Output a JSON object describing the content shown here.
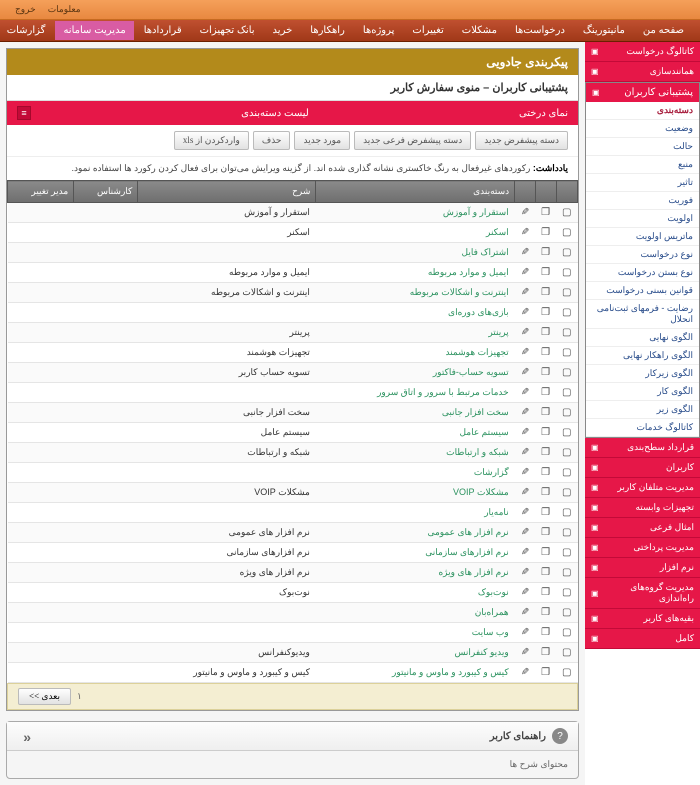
{
  "topbar": {
    "items": [
      "معلومات",
      "خروج"
    ]
  },
  "mainnav": {
    "items": [
      "صفحه من",
      "مانیتورینگ",
      "درخواست‌ها",
      "مشکلات",
      "تغییرات",
      "پروژه‌ها",
      "راهکارها",
      "خرید",
      "بانک تجهیزات",
      "قراردادها",
      "مدیریت سامانه",
      "گزارشات"
    ],
    "activeIndex": 10
  },
  "headerbar": {
    "right": "کاتالوگ درخواست",
    "left": "همانندسازی"
  },
  "sidebar": {
    "section1": {
      "title": "پشتیبانی کاربران",
      "links": [
        "دسته‌بندی",
        "وضعیت",
        "حالت",
        "منبع",
        "تاثیر",
        "فوریت",
        "اولویت",
        "ماتریس اولویت",
        "نوع درخواست",
        "نوع بستن درخواست",
        "قوانین بسنی درخواست",
        "رضایت - فرمهای ثبت‌نامی انحلال",
        "الگوی نهایی",
        "الگوی راهکار نهایی",
        "الگوی زیرکار",
        "الگوی کار",
        "الگوی زیر",
        "کاتالوگ خدمات"
      ],
      "activeIndex": 0
    },
    "redlinks": [
      "قرارداد سطح‌بندی",
      "کاربران",
      "مدیریت متلفان کاربر",
      "تجهیزات وابسته",
      "امثال فرعی",
      "مدیریت پرداختی",
      "نرم افزار",
      "مدیریت گروه‌های راه‌اندازی",
      "بقیه‌های کاربر",
      "کامل"
    ]
  },
  "panel": {
    "title": "پیکربندی جادویی",
    "subtitle": "پشتیبانی کاربران – منوی سفارش کاربر",
    "redbar_title": "لیست دسته‌بندی",
    "redbar_left": "نمای درختی"
  },
  "toolbar": {
    "buttons": [
      "دسته پیشفرض جدید",
      "دسته پیشفرض فرعی جدید",
      "مورد جدید",
      "حذف",
      "واردکردن از xls"
    ]
  },
  "note": {
    "bold": "یادداشت:",
    "text": " رکوردهای غیرفعال به رنگ خاکستری نشانه گذاری شده اند. از گزینه ویرایش می‌توان برای فعال کردن رکورد ها استفاده نمود."
  },
  "table": {
    "headers": [
      "",
      "",
      "",
      "دسته‌بندی",
      "شرح",
      "کارشناس",
      "مدیر تغییر"
    ],
    "rows": [
      {
        "cat": "استقرار و آموزش",
        "desc": "استقرار و آموزش"
      },
      {
        "cat": "اسکنر",
        "desc": "اسکنر"
      },
      {
        "cat": "اشتراک فایل",
        "desc": ""
      },
      {
        "cat": "ایمیل و موارد مربوطه",
        "desc": "ایمیل و موارد مربوطه"
      },
      {
        "cat": "اینترنت و اشکالات مربوطه",
        "desc": "اینترنت و اشکالات مربوطه"
      },
      {
        "cat": "بازی‌های دوره‌ای",
        "desc": ""
      },
      {
        "cat": "پرینتر",
        "desc": "پرینتر"
      },
      {
        "cat": "تجهیزات هوشمند",
        "desc": "تجهیزات هوشمند"
      },
      {
        "cat": "تسویه حساب-فاکتور",
        "desc": "تسویه حساب کاربر"
      },
      {
        "cat": "خدمات مرتبط با سرور و اتاق سرور",
        "desc": ""
      },
      {
        "cat": "سخت افزار جانبی",
        "desc": "سخت افزار جانبی"
      },
      {
        "cat": "سیستم عامل",
        "desc": "سیستم عامل"
      },
      {
        "cat": "شبکه و ارتباطات",
        "desc": "شبکه و ارتباطات"
      },
      {
        "cat": "گزارشات",
        "desc": ""
      },
      {
        "cat": "مشکلات VOIP",
        "desc": "مشکلات VOIP"
      },
      {
        "cat": "نامه‌یار",
        "desc": ""
      },
      {
        "cat": "نرم افزار های عمومی",
        "desc": "نرم افزار های عمومی"
      },
      {
        "cat": "نرم افزارهای سازمانی",
        "desc": "نرم افزارهای سازمانی"
      },
      {
        "cat": "نرم افزار های ویژه",
        "desc": "نرم افزار های ویژه"
      },
      {
        "cat": "نوت‌بوک",
        "desc": "نوت‌بوک"
      },
      {
        "cat": "همراه‌بان",
        "desc": ""
      },
      {
        "cat": "وب سایت",
        "desc": ""
      },
      {
        "cat": "ویدیو کنفرانس",
        "desc": "ویدیوکنفرانس"
      },
      {
        "cat": "کیس و کیبورد و ماوس و مانیتور",
        "desc": "کیس و کیبورد و ماوس و مانیتور"
      }
    ]
  },
  "footer": {
    "page": "۱",
    "next": "بعدی >>"
  },
  "help": {
    "title": "راهنمای کاربر",
    "body": "محتوای شرح ها"
  }
}
